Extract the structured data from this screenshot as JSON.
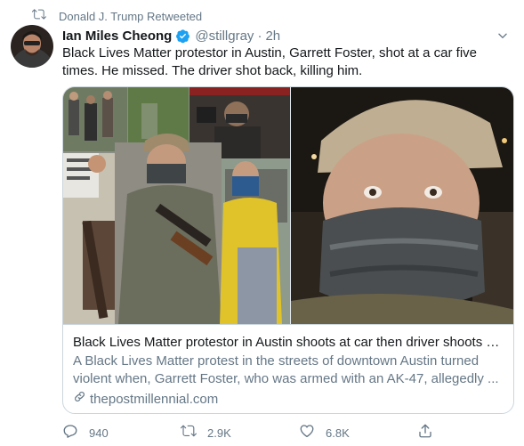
{
  "retweet": {
    "icon": "retweet-icon",
    "text": "Donald J. Trump Retweeted"
  },
  "author": {
    "name": "Ian Miles Cheong",
    "verified": true,
    "handle": "@stillgray",
    "separator": "·",
    "time": "2h"
  },
  "tweet": {
    "text": "Black Lives Matter protestor in Austin, Garrett Foster, shot at a car five times. He missed. The driver shot back, killing him."
  },
  "card": {
    "title": "Black Lives Matter protestor in Austin shoots at car then driver shoots b...",
    "description": "A Black Lives Matter protest in the streets of downtown Austin turned violent when, Garrett Foster, who was armed with an AK-47, allegedly ...",
    "domain": "thepostmillennial.com",
    "domain_icon": "link-icon"
  },
  "actions": {
    "reply_count": "940",
    "retweet_count": "2.9K",
    "like_count": "6.8K"
  },
  "colors": {
    "text_primary": "#14171a",
    "text_secondary": "#657786",
    "border": "#ccd6dd",
    "verified_blue": "#1da1f2"
  }
}
